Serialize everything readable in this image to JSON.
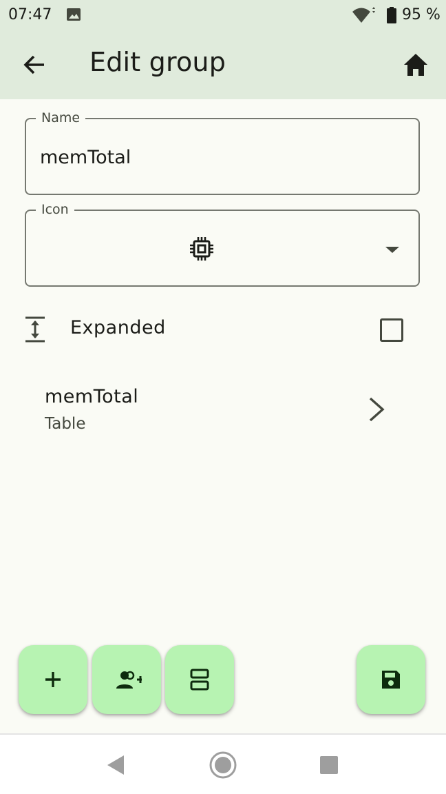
{
  "status_bar": {
    "time": "07:47",
    "battery_percent": "95 %",
    "icons": [
      "image-notification-icon",
      "wifi-icon",
      "battery-icon"
    ]
  },
  "app_bar": {
    "title": "Edit group",
    "back_icon": "arrow-back-icon",
    "home_icon": "home-icon",
    "background": "#e0ebdc"
  },
  "form": {
    "name_label": "Name",
    "name_value": "memTotal",
    "icon_label": "Icon",
    "icon_value": "chip-icon"
  },
  "expanded": {
    "label": "Expanded",
    "checked": false
  },
  "items": [
    {
      "title": "memTotal",
      "subtitle": "Table"
    }
  ],
  "fabs": [
    {
      "name": "add",
      "icon": "plus-icon"
    },
    {
      "name": "add-person",
      "icon": "person-add-icon"
    },
    {
      "name": "split",
      "icon": "split-view-icon"
    },
    {
      "name": "save",
      "icon": "save-icon"
    }
  ],
  "colors": {
    "fab": "#b7f3b2",
    "background": "#fafbf5",
    "outline": "#757870"
  }
}
